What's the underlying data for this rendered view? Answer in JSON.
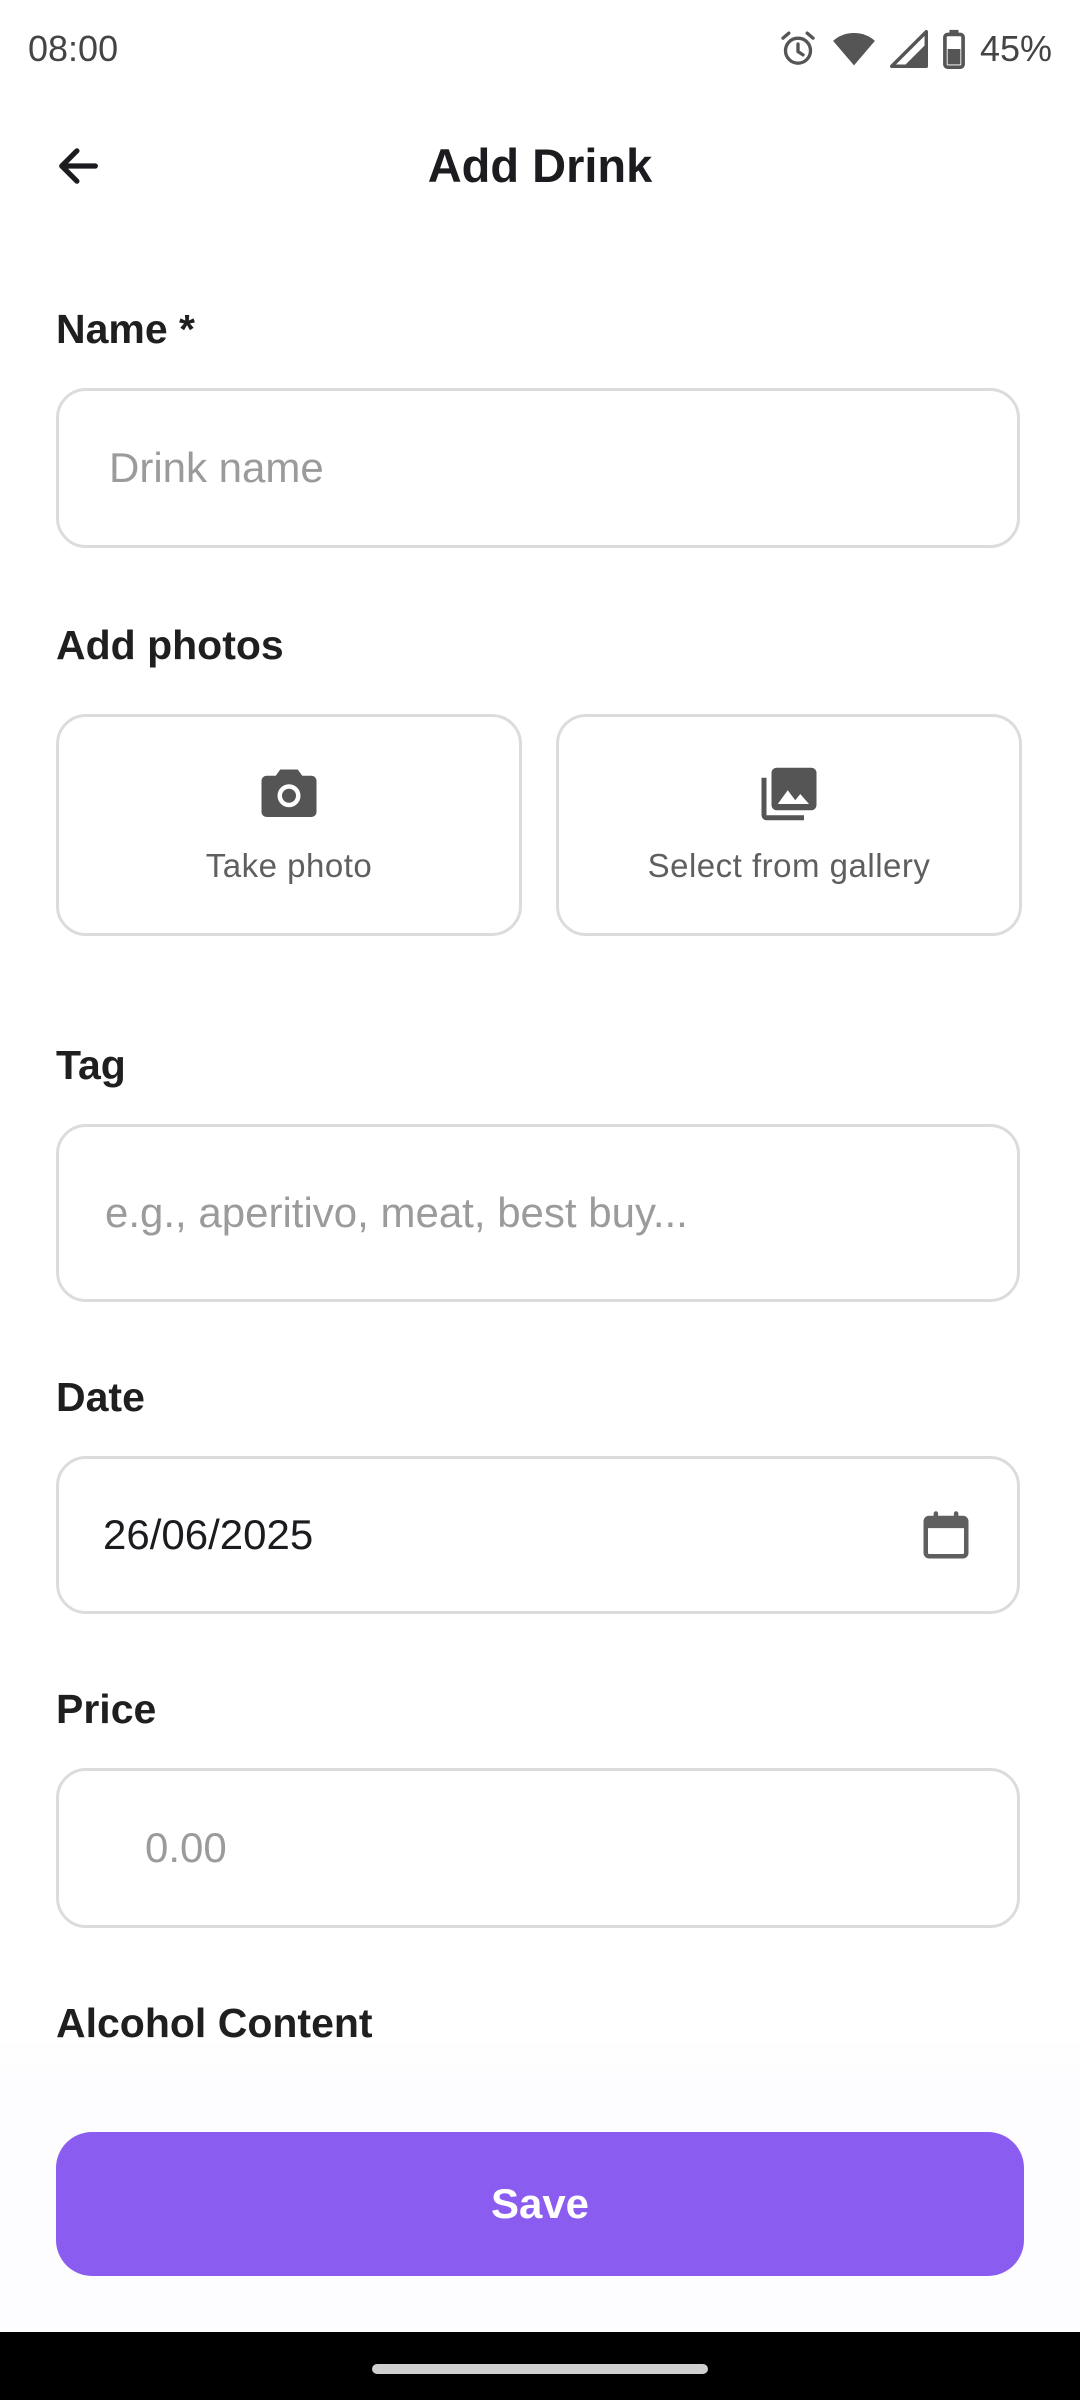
{
  "status_bar": {
    "time": "08:00",
    "battery": "45%",
    "icons": [
      "alarm-icon",
      "wifi-icon",
      "cell-signal-icon",
      "battery-icon"
    ]
  },
  "app_bar": {
    "title": "Add Drink",
    "back_icon": "arrow-back-icon"
  },
  "form": {
    "name": {
      "label": "Name *",
      "placeholder": "Drink name",
      "value": ""
    },
    "photos": {
      "label": "Add photos",
      "take_photo": {
        "label": "Take photo",
        "icon": "camera-icon"
      },
      "gallery": {
        "label": "Select from gallery",
        "icon": "photo-library-icon"
      }
    },
    "tag": {
      "label": "Tag",
      "placeholder": "e.g., aperitivo, meat, best buy...",
      "value": ""
    },
    "date": {
      "label": "Date",
      "value": "26/06/2025",
      "icon": "calendar-icon"
    },
    "price": {
      "label": "Price",
      "placeholder": "0.00",
      "value": ""
    },
    "alcohol": {
      "label": "Alcohol Content"
    }
  },
  "save_button": {
    "label": "Save"
  },
  "colors": {
    "accent": "#8b5cf0",
    "border": "#dcdcdc",
    "placeholder": "#9b9b9b"
  }
}
